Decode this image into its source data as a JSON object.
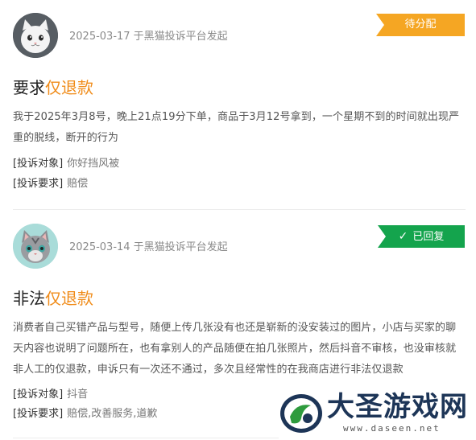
{
  "complaints": [
    {
      "date_text": "2025-03-17 于黑猫投诉平台发起",
      "status": "待分配",
      "title_prefix": "要求",
      "title_highlight": "仅退款",
      "description": "我于2025年3月8号，晚上21点19分下单，商品于3月12号拿到，一个星期不到的时间就出现严重的脱线，断开的行为",
      "target_label": "[投诉对象]",
      "target_value": "你好挡风被",
      "demand_label": "[投诉要求]",
      "demand_value": "赔偿"
    },
    {
      "date_text": "2025-03-14 于黑猫投诉平台发起",
      "status": "已回复",
      "title_prefix": "非法",
      "title_highlight": "仅退款",
      "description": "消费者自己买错产品与型号，随便上传几张没有也还是崭新的没安装过的图片，小店与买家的聊天内容也说明了问题所在，也有拿别人的产品随便在拍几张照片，然后抖音不审核，也没审核就非人工的仅退款，申诉只有一次还不通过，多次且经常性的在我商店进行非法仅退款",
      "target_label": "[投诉对象]",
      "target_value": "抖音",
      "demand_label": "[投诉要求]",
      "demand_value": "赔偿,改善服务,道歉"
    }
  ],
  "watermark": {
    "text": "大圣游戏网",
    "url": "www.daseen.net"
  },
  "colors": {
    "pending": "#f5a623",
    "replied": "#14a44d",
    "highlight": "#f08c1a"
  },
  "icons": {
    "avatar1": "gray-cat-avatar",
    "avatar2": "tabby-cat-avatar",
    "replied_check": "check-icon"
  }
}
